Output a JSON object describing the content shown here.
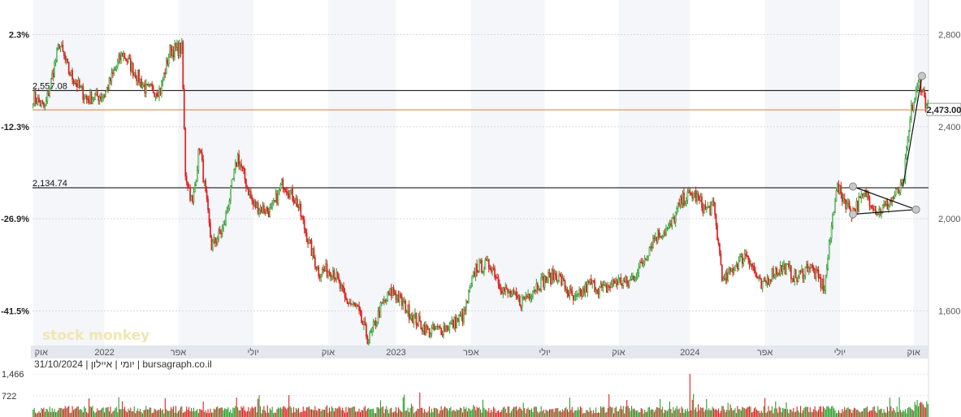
{
  "chart_data": {
    "type": "candlestick",
    "source_caption": "יומי | איילון | 31/10/2024 | bursagraph.co.il",
    "watermark": "stock monkey",
    "y_right": {
      "min": 1450,
      "max": 2950,
      "ticks": [
        "2,800",
        "2,400",
        "2,000",
        "1,600"
      ],
      "tick_values": [
        2800,
        2400,
        2000,
        1600
      ]
    },
    "y_left": {
      "ticks": [
        "2.3%",
        "-12.3%",
        "-26.9%",
        "-41.5%"
      ],
      "tick_values": [
        2800,
        2400,
        2000,
        1600
      ]
    },
    "x_labels": [
      "אוק",
      "2022",
      "אפר",
      "יולי",
      "אוק",
      "2023",
      "אפר",
      "יולי",
      "אוק",
      "2024",
      "אפר",
      "יולי",
      "אוק"
    ],
    "x_label_idx": [
      0,
      60,
      122,
      185,
      248,
      305,
      368,
      430,
      492,
      552,
      615,
      678,
      740
    ],
    "levels": [
      {
        "value": 2557.08,
        "label": "2,557.08",
        "color": "#000000"
      },
      {
        "value": 2134.74,
        "label": "2,134.74",
        "color": "#000000"
      },
      {
        "value": 2473.0,
        "label": "2,473.00",
        "color": "#d08040",
        "last_price": true
      }
    ],
    "series_anchors": [
      [
        0,
        2530
      ],
      [
        10,
        2480
      ],
      [
        22,
        2760
      ],
      [
        30,
        2640
      ],
      [
        45,
        2520
      ],
      [
        60,
        2540
      ],
      [
        75,
        2720
      ],
      [
        85,
        2640
      ],
      [
        95,
        2560
      ],
      [
        107,
        2560
      ],
      [
        115,
        2730
      ],
      [
        125,
        2740
      ],
      [
        128,
        2200
      ],
      [
        134,
        2060
      ],
      [
        140,
        2320
      ],
      [
        150,
        1880
      ],
      [
        160,
        1960
      ],
      [
        172,
        2270
      ],
      [
        185,
        2060
      ],
      [
        200,
        2030
      ],
      [
        210,
        2160
      ],
      [
        222,
        2070
      ],
      [
        232,
        1890
      ],
      [
        240,
        1770
      ],
      [
        252,
        1780
      ],
      [
        262,
        1650
      ],
      [
        272,
        1610
      ],
      [
        282,
        1470
      ],
      [
        292,
        1610
      ],
      [
        302,
        1690
      ],
      [
        312,
        1620
      ],
      [
        322,
        1560
      ],
      [
        332,
        1510
      ],
      [
        342,
        1520
      ],
      [
        352,
        1540
      ],
      [
        362,
        1580
      ],
      [
        372,
        1790
      ],
      [
        385,
        1800
      ],
      [
        395,
        1690
      ],
      [
        410,
        1640
      ],
      [
        425,
        1720
      ],
      [
        440,
        1760
      ],
      [
        455,
        1640
      ],
      [
        468,
        1720
      ],
      [
        480,
        1690
      ],
      [
        490,
        1730
      ],
      [
        500,
        1720
      ],
      [
        510,
        1790
      ],
      [
        522,
        1920
      ],
      [
        535,
        1960
      ],
      [
        545,
        2080
      ],
      [
        555,
        2110
      ],
      [
        565,
        2040
      ],
      [
        572,
        2050
      ],
      [
        580,
        1720
      ],
      [
        590,
        1800
      ],
      [
        600,
        1850
      ],
      [
        612,
        1700
      ],
      [
        622,
        1770
      ],
      [
        632,
        1790
      ],
      [
        642,
        1740
      ],
      [
        652,
        1800
      ],
      [
        665,
        1700
      ],
      [
        675,
        2140
      ],
      [
        688,
        2030
      ],
      [
        700,
        2110
      ],
      [
        710,
        2030
      ],
      [
        718,
        2060
      ],
      [
        724,
        2100
      ],
      [
        731,
        2140
      ],
      [
        738,
        2470
      ],
      [
        745,
        2600
      ],
      [
        752,
        2473
      ]
    ],
    "n_days": 753,
    "volume": {
      "ticks": [
        "1,466",
        "722"
      ],
      "tick_values": [
        1466,
        722
      ],
      "max": 1466
    },
    "trendlines": [
      {
        "from": [
          689,
          2020
        ],
        "to": [
          742,
          2040
        ]
      },
      {
        "from": [
          742,
          2040
        ],
        "to": [
          689,
          2140
        ]
      },
      {
        "from": [
          731,
          2140
        ],
        "to": [
          747,
          2620
        ]
      }
    ],
    "pivot_points": [
      [
        689,
        2140
      ],
      [
        742,
        2040
      ],
      [
        747,
        2620
      ],
      [
        689,
        2020
      ]
    ]
  }
}
